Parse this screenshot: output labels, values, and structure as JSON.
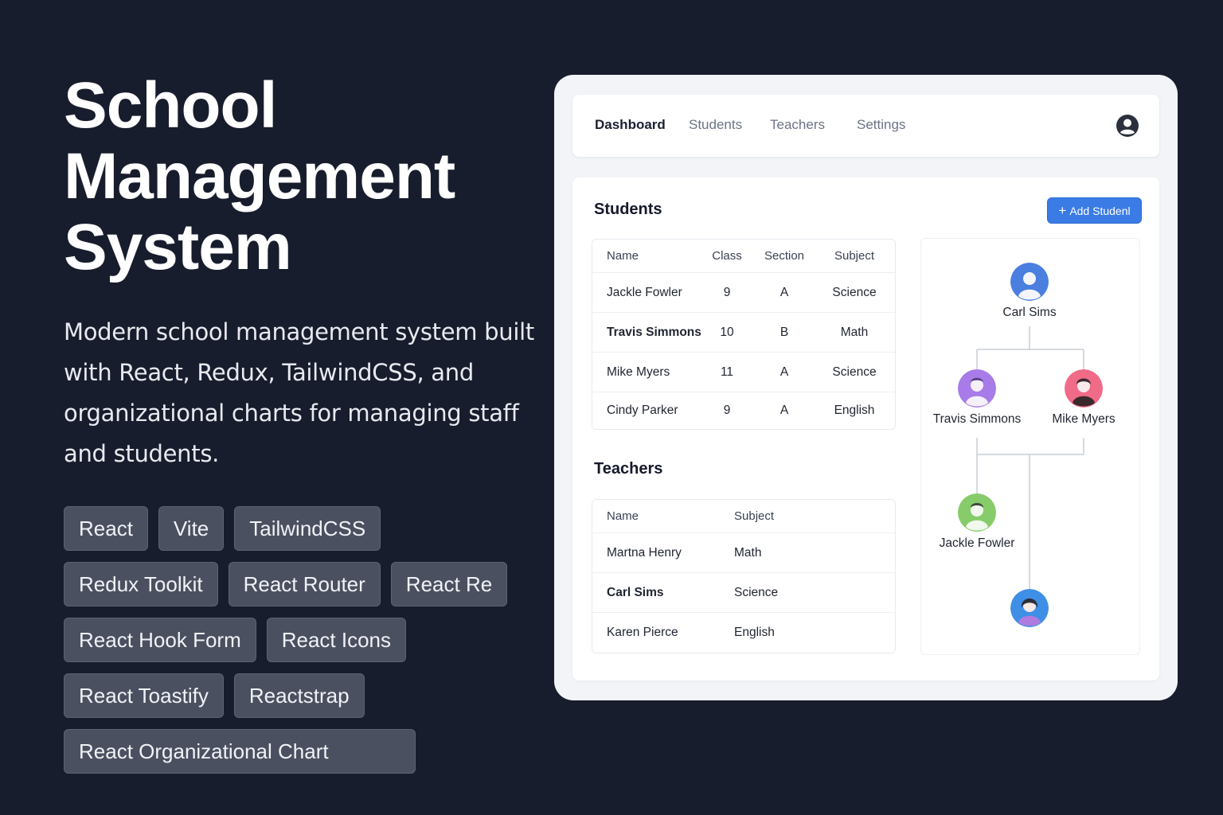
{
  "hero": {
    "title_lines": [
      "School",
      "Management",
      "System"
    ],
    "description": "Modern school management system built with React, Redux, TailwindCSS, and organizational charts for managing staff and students.",
    "tags": [
      "React",
      "Vite",
      "TailwindCSS",
      "Redux Toolkit",
      "React Router",
      "React Re",
      "React Hook Form",
      "React Icons",
      "React Toastify",
      "Reactstrap",
      "React Organizational Chart"
    ]
  },
  "nav": {
    "items": [
      "Dashboard",
      "Students",
      "Teachers",
      "Settings"
    ],
    "active": "Dashboard",
    "account_icon": "user-circle-icon"
  },
  "students": {
    "title": "Students",
    "add_button": "Add Studenl",
    "add_icon": "plus-icon",
    "headers": [
      "Name",
      "Class",
      "Section",
      "Subject"
    ],
    "rows": [
      [
        "Jackle Fowler",
        "9",
        "A",
        "Science"
      ],
      [
        "Travis Simmons",
        "10",
        "B",
        "Math"
      ],
      [
        "Mike Myers",
        "11",
        "A",
        "Science"
      ],
      [
        "Cindy Parker",
        "9",
        "A",
        "English"
      ]
    ]
  },
  "teachers": {
    "title": "Teachers",
    "headers": [
      "Name",
      "Subject"
    ],
    "rows": [
      [
        "Martna Henry",
        "Math"
      ],
      [
        "Carl Sims",
        "Science"
      ],
      [
        "Karen Pierce",
        "English"
      ]
    ]
  },
  "org_chart": {
    "nodes": [
      {
        "name": "Carl Sims",
        "color": "#4a7fe0"
      },
      {
        "name": "Travis Simmons",
        "color": "#a77be8"
      },
      {
        "name": "Mike Myers",
        "color": "#f06b88"
      },
      {
        "name": "Jackle Fowler",
        "color": "#86cc6a"
      },
      {
        "name": "",
        "color": "#3f8fe6"
      }
    ]
  },
  "colors": {
    "background": "#181d2d",
    "accent": "#3a7be6",
    "tag_bg": "#4a5060"
  }
}
